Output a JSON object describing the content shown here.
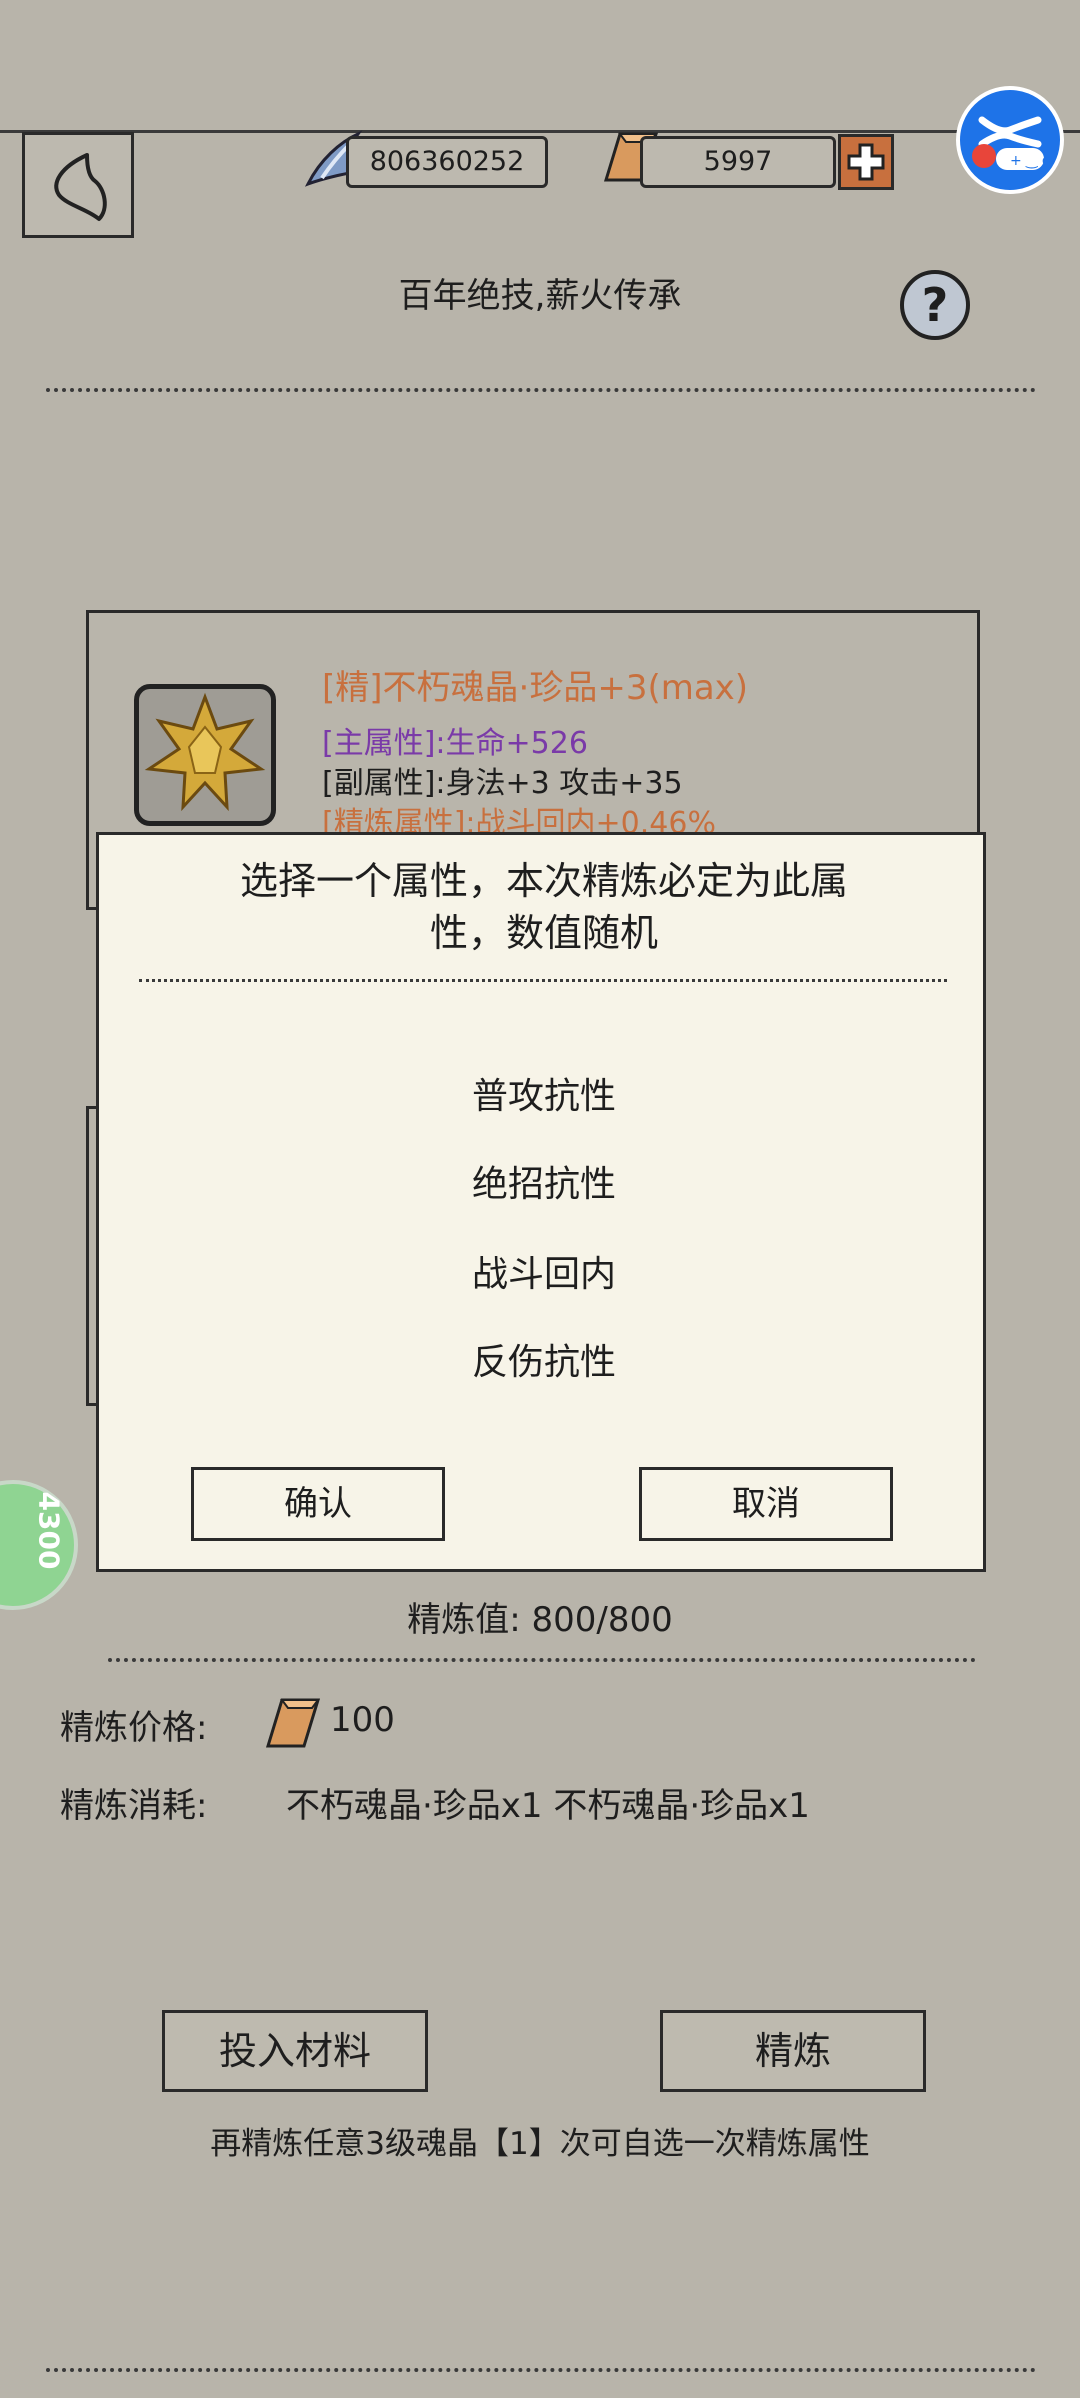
{
  "header": {
    "currency1": "806360252",
    "currency2": "5997",
    "subtitle": "百年绝技,薪火传承",
    "help": "?"
  },
  "item": {
    "name": "[精]不朽魂晶·珍品+3(max)",
    "main_attr": "[主属性]:生命+526",
    "sub_attr": "[副属性]:身法+3 攻击+35",
    "refine_attr": "[精炼属性]:战斗回内+0.46%"
  },
  "dialog": {
    "title": "选择一个属性，本次精炼必定为此属性，数值随机",
    "title_line1": "选择一个属性，本次精炼必定为此属",
    "title_line2": "性，数值随机",
    "options": [
      "普攻抗性",
      "绝招抗性",
      "战斗回内",
      "反伤抗性"
    ],
    "confirm": "确认",
    "cancel": "取消"
  },
  "refine": {
    "value_text": "精炼值:  800/800",
    "price_label": "精炼价格:",
    "price_value": "100",
    "cost_label": "精炼消耗:",
    "cost_items": "不朽魂晶·珍品x1 不朽魂晶·珍品x1",
    "add_material": "投入材料",
    "refine_button": "精炼",
    "hint": "再精炼任意3级魂晶【1】次可自选一次精炼属性"
  },
  "side_badge": "4300",
  "colors": {
    "item_name": "#c8703e",
    "main_attr": "#7a3aa8",
    "refine_attr": "#c8703e",
    "gold": "#c9a33a"
  }
}
